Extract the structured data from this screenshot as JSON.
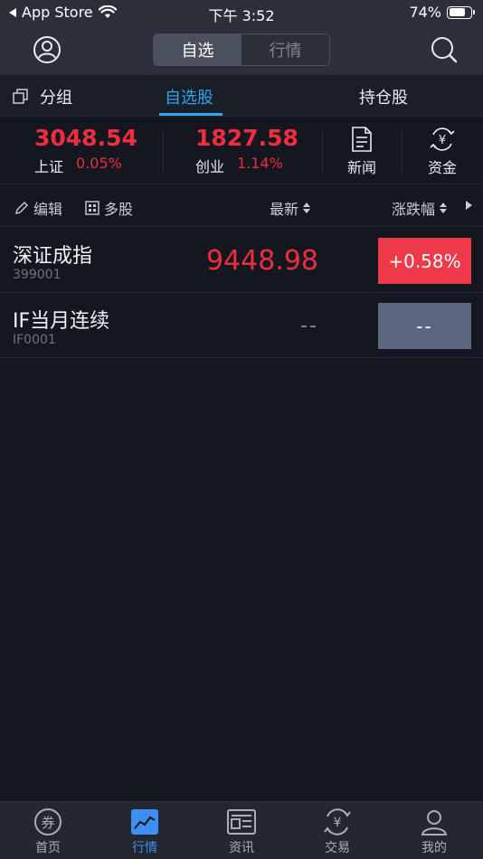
{
  "status_bar": {
    "back_app": "App Store",
    "time": "下午 3:52",
    "battery": "74%",
    "battery_level": 0.74
  },
  "nav": {
    "segments": [
      {
        "label": "自选"
      },
      {
        "label": "行情"
      }
    ]
  },
  "tabs": {
    "group": "分组",
    "watchlist": "自选股",
    "holdings": "持仓股"
  },
  "indices": [
    {
      "value": "3048.54",
      "name": "上证",
      "change": "0.05%"
    },
    {
      "value": "1827.58",
      "name": "创业",
      "change": "1.14%"
    }
  ],
  "quick_links": {
    "news": "新闻",
    "funds": "资金"
  },
  "toolbar": {
    "edit": "编辑",
    "multi": "多股",
    "latest": "最新",
    "change": "涨跌幅"
  },
  "rows": [
    {
      "name": "深证成指",
      "code": "399001",
      "price": "9448.98",
      "change": "+0.58%"
    },
    {
      "name": "IF当月连续",
      "code": "IF0001",
      "price": "--",
      "change": "--"
    }
  ],
  "colors": {
    "up": "#ee2e3f",
    "accent": "#2ea7f0",
    "inactive_badge": "#5c6680",
    "nav_bg": "#2a2f39",
    "page_bg": "#14171f"
  },
  "bottom_tabs": [
    {
      "label": "首页",
      "icon": "coupon-icon"
    },
    {
      "label": "行情",
      "icon": "chart-icon"
    },
    {
      "label": "资讯",
      "icon": "news-icon"
    },
    {
      "label": "交易",
      "icon": "yen-cycle-icon"
    },
    {
      "label": "我的",
      "icon": "user-icon"
    }
  ]
}
